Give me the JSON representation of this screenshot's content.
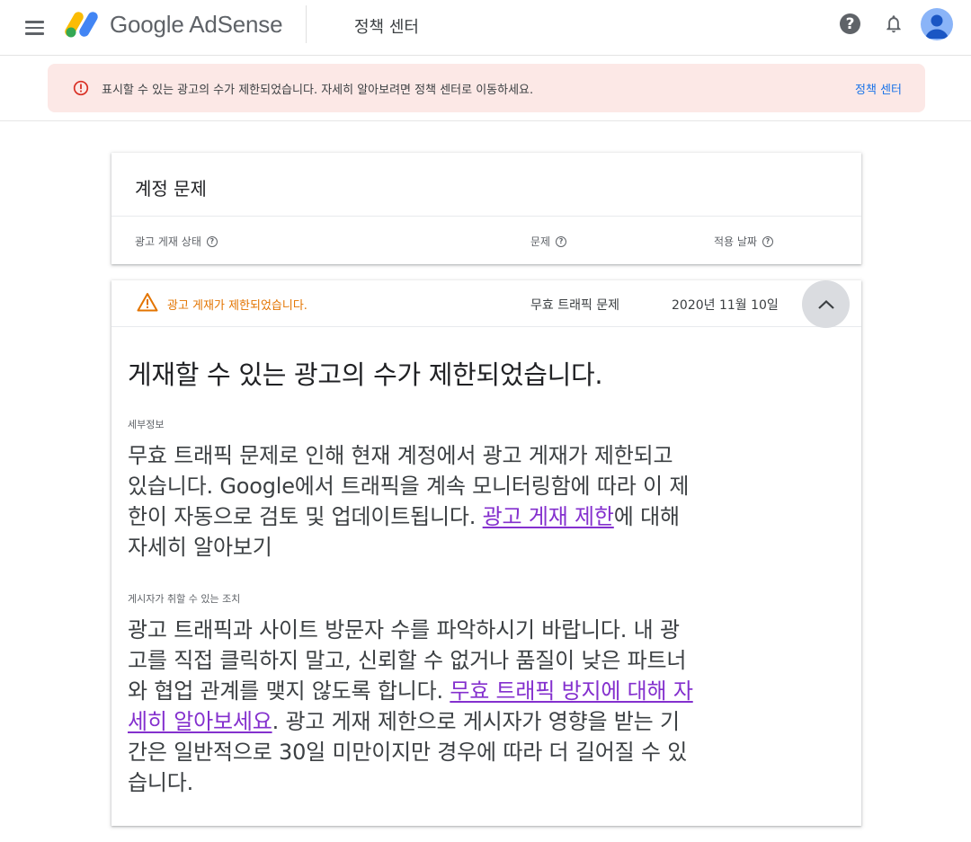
{
  "header": {
    "product_name": "Google AdSense",
    "page_name": "정책 센터",
    "help_symbol": "?"
  },
  "banner": {
    "message": "표시할 수 있는 광고의 수가 제한되었습니다. 자세히 알아보려면 정책 센터로 이동하세요.",
    "link_label": "정책 센터"
  },
  "issues_card": {
    "title": "계정 문제",
    "columns": [
      {
        "label": "광고 게재 상태"
      },
      {
        "label": "문제"
      },
      {
        "label": "적용 날짜"
      }
    ],
    "help_symbol": "?"
  },
  "issue": {
    "status": "광고 게재가 제한되었습니다.",
    "type": "무효 트래픽 문제",
    "date": "2020년 11월 10일"
  },
  "detail": {
    "heading": "게재할 수 있는 광고의 수가 제한되었습니다.",
    "details_label": "세부정보",
    "details_text": "무효 트래픽 문제로 인해 현재 계정에서 광고 게재가 제한되고 있습니다. Google에서 트래픽을 계속 모니터링함에 따라 이 제한이 자동으로 검토 및 업데이트됩니다. ",
    "details_link": "광고 게재 제한",
    "details_after": "에 대해 자세히 알아보기",
    "actions_label": "게시자가 취할 수 있는 조치",
    "actions_text": "광고 트래픽과 사이트 방문자 수를 파악하시기 바랍니다. 내 광고를 직접 클릭하지 말고, 신뢰할 수 없거나 품질이 낮은 파트너와 협업 관계를 맺지 않도록 합니다. ",
    "actions_link": "무효 트래픽 방지에 대해 자세히 알아보세요",
    "actions_after": ". 광고 게재 제한으로 게시자가 영향을 받는 기간은 일반적으로 30일 미만이지만 경우에 따라 더 길어질 수 있습니다."
  },
  "colors": {
    "banner_bg": "#fce8e6",
    "warning": "#e37400",
    "link_visited": "#8430ce",
    "link": "#1a73e8",
    "error": "#d93025"
  },
  "icons": [
    "menu-icon",
    "adsense-logo",
    "help-icon",
    "bell-icon",
    "avatar",
    "error-icon",
    "warning-icon",
    "chevron-up-icon"
  ]
}
